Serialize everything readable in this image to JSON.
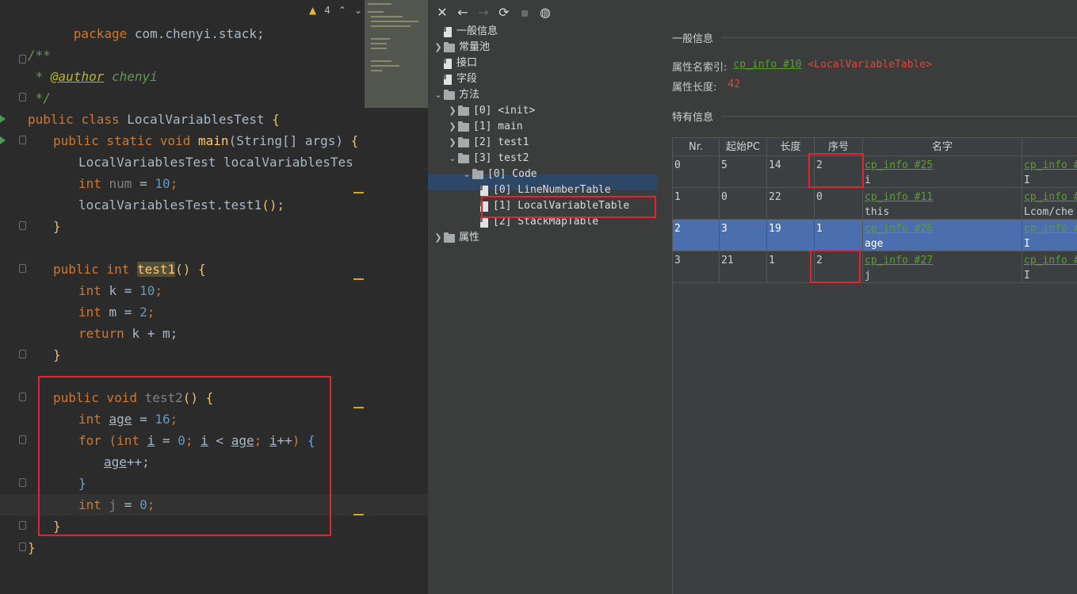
{
  "editor": {
    "lines": {
      "package": "package com.chenyi.stack;",
      "doc_open": "/**",
      "doc_author_prefix": " * ",
      "doc_author_tag": "@author",
      "doc_author_name": " chenyi",
      "doc_close": " */",
      "class_kw": "public class ",
      "class_name": "LocalVariablesTest ",
      "main_sig_kw": "public static void ",
      "main_name": "main",
      "main_params": "(String[] args) ",
      "main_l1": "LocalVariablesTest localVariablesTes",
      "main_l2_type": "int ",
      "main_l2_var": "num",
      "main_l2_eq": " = ",
      "main_l2_val": "10",
      "main_l2_end": ";",
      "main_l3": "localVariablesTest.test1",
      "main_l3_end": "();",
      "test1_kw": "public int ",
      "test1_name": "test1",
      "test1_end": "() ",
      "t1_l1_type": "int ",
      "t1_l1_rest": "k = ",
      "t1_l1_val": "10",
      "t1_l2_rest": "m = ",
      "t1_l2_val": "2",
      "t1_ret_kw": "return ",
      "t1_ret_rest": "k + m;",
      "test2_kw": "public void ",
      "test2_name": "test2",
      "test2_end": "() ",
      "t2_l1_type": "int ",
      "t2_l1_var": "age",
      "t2_l1_eq": " = ",
      "t2_l1_val": "16",
      "t2_for_kw": "for ",
      "t2_for_int": "int ",
      "t2_for_i": "i",
      "t2_for_eq": " = ",
      "t2_for_zero": "0",
      "t2_for_semi": "; ",
      "t2_for_i2": "i",
      "t2_for_lt": " < ",
      "t2_for_age": "age",
      "t2_for_semi2": "; ",
      "t2_for_i3": "i",
      "t2_for_inc": "++",
      "t2_body_var": "age",
      "t2_body_rest": "++;",
      "t2_j_type": "int ",
      "t2_j_var": "j",
      "t2_j_eq": " = ",
      "t2_j_val": "0",
      "open_brace": "{",
      "close_brace": "}",
      "semicolon": ";",
      "paren_open": "(",
      "paren_close": ")",
      "paren_close_sp": ") "
    },
    "inspection_count": "4"
  },
  "toolbar": {
    "close": "✕",
    "back": "←",
    "forward": "→",
    "refresh": "⟳",
    "save": "▪",
    "web": "◍"
  },
  "tree": {
    "items": [
      {
        "label": "一般信息"
      },
      {
        "label": "常量池"
      },
      {
        "label": "接口"
      },
      {
        "label": "字段"
      },
      {
        "label": "方法"
      },
      {
        "label": "[0] <init>"
      },
      {
        "label": "[1] main"
      },
      {
        "label": "[2] test1"
      },
      {
        "label": "[3] test2"
      },
      {
        "label": "[0] Code"
      },
      {
        "label": "[0] LineNumberTable"
      },
      {
        "label": "[1] LocalVariableTable"
      },
      {
        "label": "[2] StackMapTable"
      },
      {
        "label": "属性"
      }
    ]
  },
  "info": {
    "general_title": "一般信息",
    "attr_name_label": "属性名索引:",
    "attr_name_link": "cp_info #10",
    "attr_name_value": "<LocalVariableTable>",
    "attr_len_label": "属性长度:",
    "attr_len_value": "42",
    "specific_title": "特有信息"
  },
  "table": {
    "headers": [
      "Nr.",
      "起始PC",
      "长度",
      "序号",
      "名字",
      ""
    ],
    "rows": [
      {
        "nr": "0",
        "pc": "5",
        "len": "14",
        "idx": "2",
        "name_link": "cp_info #25",
        "name": "i",
        "desc_link": "cp_info #",
        "desc": "I"
      },
      {
        "nr": "1",
        "pc": "0",
        "len": "22",
        "idx": "0",
        "name_link": "cp_info #11",
        "name": "this",
        "desc_link": "cp_info #",
        "desc": "Lcom/che"
      },
      {
        "nr": "2",
        "pc": "3",
        "len": "19",
        "idx": "1",
        "name_link": "cp_info #26",
        "name": "age",
        "desc_link": "cp_info #",
        "desc": "I"
      },
      {
        "nr": "3",
        "pc": "21",
        "len": "1",
        "idx": "2",
        "name_link": "cp_info #27",
        "name": "j",
        "desc_link": "cp_info #",
        "desc": "I"
      }
    ]
  },
  "colors": {
    "keyword": "#cc7832",
    "number": "#6897bb",
    "method": "#ffc66d",
    "comment": "#629755",
    "link": "#5a9f2e",
    "highlight_box": "#e0262f",
    "selection": "#4b6eaf"
  }
}
